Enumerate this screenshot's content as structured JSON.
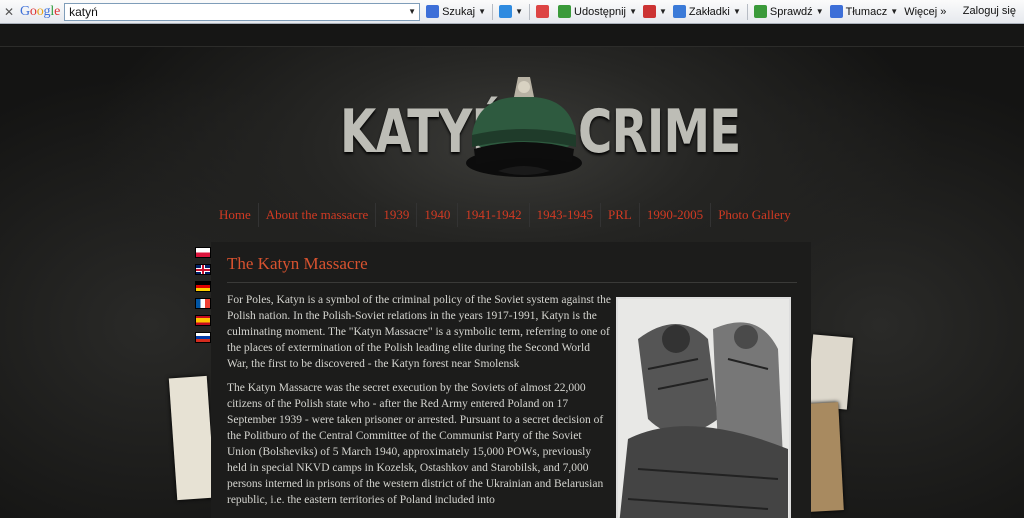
{
  "toolbar": {
    "logo": "Google",
    "search_value": "katyń",
    "buttons": [
      {
        "label": "Szukaj",
        "icon": "search-icon"
      },
      {
        "label": "",
        "icon": "plus-icon"
      },
      {
        "label": "",
        "icon": "google-plus-icon"
      },
      {
        "label": "Udostępnij",
        "icon": "share-icon"
      },
      {
        "label": "",
        "icon": "popup-blocker-icon"
      },
      {
        "label": "Zakładki",
        "icon": "star-icon"
      },
      {
        "label": "Sprawdź",
        "icon": "spellcheck-icon"
      },
      {
        "label": "Tłumacz",
        "icon": "translate-icon"
      },
      {
        "label": "Więcej »",
        "icon": ""
      }
    ],
    "login": "Zaloguj się"
  },
  "site": {
    "logo_left": "KATYŃ",
    "logo_right": "CRIME",
    "nav": [
      "Home",
      "About the massacre",
      "1939",
      "1940",
      "1941-1942",
      "1943-1945",
      "PRL",
      "1990-2005",
      "Photo Gallery"
    ],
    "flags": [
      "pl-flag",
      "uk-flag",
      "de-flag",
      "fr-flag",
      "es-flag",
      "ru-flag"
    ]
  },
  "article": {
    "title": "The Katyn Massacre",
    "p1": "For Poles, Katyn is a symbol of the criminal policy of the Soviet system against the Polish nation. In the Polish-Soviet relations in the years 1917-1991, Katyn is the culminating moment. The \"Katyn Massacre\" is a symbolic term, referring to one of the places of extermination of the Polish leading elite during the Second World War, the first to be discovered - the Katyn forest near Smolensk",
    "p2": "The Katyn Massacre was the secret execution by the Soviets of almost 22,000 citizens of the Polish state who - after the Red Army entered Poland on 17 September 1939 - were taken prisoner or arrested. Pursuant to a secret decision of the Politburo of the Central Committee of the Communist Party of the Soviet Union (Bolsheviks) of 5 March 1940, approximately 15,000 POWs, previously held in special NKVD camps in Kozelsk, Ostashkov and Starobilsk, and 7,000 persons interned in prisons of the western district of the Ukrainian and Belarusian republic, i.e. the eastern territories of Poland included into"
  }
}
